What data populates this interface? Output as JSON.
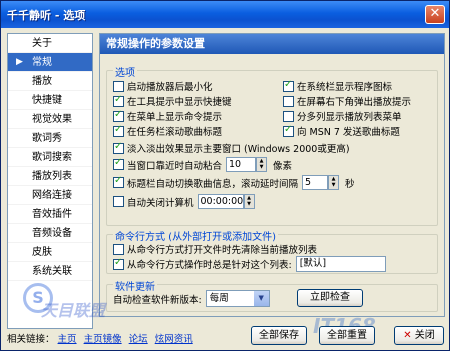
{
  "window": {
    "title": "千千静听 - 选项",
    "close_glyph": "✕"
  },
  "sidebar": {
    "items": [
      {
        "label": "关于",
        "selected": false
      },
      {
        "label": "常规",
        "selected": true
      },
      {
        "label": "播放",
        "selected": false
      },
      {
        "label": "快捷键",
        "selected": false
      },
      {
        "label": "视觉效果",
        "selected": false
      },
      {
        "label": "歌词秀",
        "selected": false
      },
      {
        "label": "歌词搜索",
        "selected": false
      },
      {
        "label": "播放列表",
        "selected": false
      },
      {
        "label": "网络连接",
        "selected": false
      },
      {
        "label": "音效插件",
        "selected": false
      },
      {
        "label": "音频设备",
        "selected": false
      },
      {
        "label": "皮肤",
        "selected": false
      },
      {
        "label": "系统关联",
        "selected": false
      }
    ]
  },
  "main": {
    "header": "常规操作的参数设置",
    "options_group": {
      "title": "选项",
      "left_col": [
        {
          "label": "启动播放器后最小化",
          "checked": false
        },
        {
          "label": "在工具提示中显示快捷键",
          "checked": true
        },
        {
          "label": "在菜单上显示命令提示",
          "checked": true
        },
        {
          "label": "在任务栏滚动歌曲标题",
          "checked": true
        }
      ],
      "right_col": [
        {
          "label": "在系统栏显示程序图标",
          "checked": true
        },
        {
          "label": "在屏幕右下角弹出播放提示",
          "checked": false
        },
        {
          "label": "分多列显示播放列表菜单",
          "checked": false
        },
        {
          "label": "向 MSN 7 发送歌曲标题",
          "checked": true
        }
      ],
      "fade_row": {
        "label": "淡入淡出效果显示主要窗口 (Windows 2000或更高)",
        "checked": true
      },
      "snap_row": {
        "label": "当窗口靠近时自动粘合",
        "value": "10",
        "unit": "像素",
        "checked": true
      },
      "scroll_row": {
        "label": "标题栏自动切换歌曲信息，滚动延时间隔",
        "value": "5",
        "unit": "秒",
        "checked": true
      },
      "shutdown_row": {
        "label": "自动关闭计算机",
        "value": "00:00:00",
        "checked": false
      }
    },
    "cmdline_group": {
      "title": "命令行方式 (从外部打开或添加文件)",
      "row1": {
        "label": "从命令行方式打开文件时先清除当前播放列表",
        "checked": false
      },
      "row2": {
        "label": "从命令行方式操作时总是针对这个列表:",
        "value": "[默认]",
        "checked": true
      }
    },
    "update_group": {
      "title": "软件更新",
      "label": "自动检查软件新版本:",
      "selected": "每周",
      "check_button": "立即检查"
    }
  },
  "footer": {
    "links_label": "相关链接：",
    "links": [
      "主页",
      "主页镜像",
      "论坛",
      "炫网资讯"
    ]
  },
  "buttons": {
    "save_all": "全部保存",
    "reset_all": "全部重置",
    "close": "关闭"
  },
  "watermark": {
    "logo_glyph": "S",
    "text": "天目联盟",
    "text2": "IT168"
  },
  "colors": {
    "title_bar": "#0a5ee0",
    "selection": "#316ac5",
    "group_title": "#0046d5"
  }
}
